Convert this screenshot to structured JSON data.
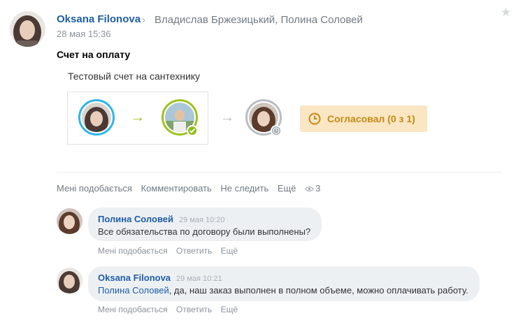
{
  "post": {
    "author": "Oksana Filonova",
    "recipients": "Владислав Бржезицький, Полина Соловей",
    "date": "28 мая 15:36",
    "title": "Счет на оплату",
    "task_title": "Тестовый счет на сантехнику",
    "status_label": "Согласовал (0 з 1)",
    "actions": {
      "like": "Мені подобається",
      "comment": "Комментировать",
      "unfollow": "Не следить",
      "more": "Ещё",
      "views": "3"
    }
  },
  "comments": [
    {
      "author": "Полина Соловей",
      "time": "29 мая 10:20",
      "mention": "",
      "text": "Все обязательства по договору были выполнены?",
      "actions": {
        "like": "Мені подобається",
        "reply": "Ответить",
        "more": "Ещё"
      }
    },
    {
      "author": "Oksana Filonova",
      "time": "29 мая 10:21",
      "mention": "Полина Соловей",
      "text": ", да, наш заказ выполнен в полном объеме, можно оплачивать работу.",
      "actions": {
        "like": "Мені подобається",
        "reply": "Ответить",
        "more": "Ещё"
      }
    }
  ],
  "colors": {
    "link": "#1f5da4",
    "step_done": "#9cc31c",
    "step_current": "#2fb5ea",
    "step_pending": "#b9bec4",
    "status_bg": "#fbe6c3",
    "status_text": "#c28a14"
  },
  "icons": {
    "star": "star-icon",
    "chevron": "chevron-right-icon",
    "arrow": "arrow-right-icon",
    "check": "check-icon",
    "clock": "clock-icon",
    "eye": "eye-icon"
  }
}
